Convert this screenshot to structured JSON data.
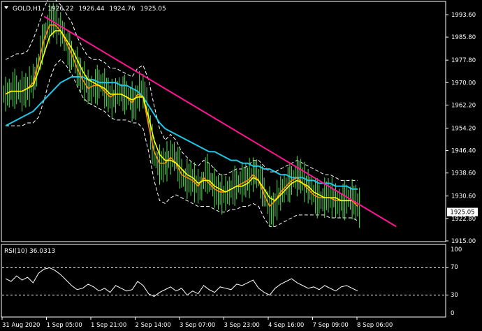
{
  "header": {
    "symbol": "GOLD,H1",
    "open": "1926.22",
    "high": "1926.44",
    "low": "1924.76",
    "close": "1925.05",
    "menu_icon": "triangle-down-icon"
  },
  "price_badge": "1925.05",
  "rsi": {
    "label": "RSI(10) 36.0313",
    "ticks": [
      "100",
      "70",
      "30",
      "0"
    ]
  },
  "colors": {
    "background": "#000000",
    "frame": "#ffffff",
    "bars": "#4fe04f",
    "ma_fast": "#ff8c00",
    "ma_slow": "#ffff00",
    "ma_long": "#1ec8e6",
    "bands": "#ffffff",
    "trendline": "#ff1493",
    "rsi_line": "#ffffff"
  },
  "chart_data": {
    "type": "line",
    "price_axis": {
      "ticks": [
        "1993.60",
        "1985.80",
        "1977.80",
        "1970.00",
        "1962.20",
        "1954.20",
        "1946.40",
        "1938.60",
        "1930.60",
        "1922.80",
        "1915.00"
      ],
      "ylim": [
        1915.0,
        1993.6
      ]
    },
    "time_axis": {
      "labels": [
        "31 Aug 2020",
        "1 Sep 05:00",
        "1 Sep 21:00",
        "2 Sep 14:00",
        "3 Sep 07:00",
        "3 Sep 23:00",
        "4 Sep 16:00",
        "7 Sep 09:00",
        "8 Sep 06:00"
      ]
    },
    "close": [
      1966,
      1968,
      1967,
      1967,
      1969,
      1972,
      1982,
      1989,
      1992,
      1990,
      1987,
      1981,
      1978,
      1973,
      1970,
      1967,
      1969,
      1970,
      1966,
      1964,
      1967,
      1966,
      1965,
      1962,
      1968,
      1966,
      1950,
      1942,
      1941,
      1943,
      1945,
      1941,
      1936,
      1937,
      1935,
      1933,
      1939,
      1935,
      1932,
      1931,
      1932,
      1934,
      1935,
      1936,
      1937,
      1939,
      1935,
      1929,
      1925,
      1930,
      1933,
      1935,
      1937,
      1938,
      1935,
      1933,
      1930,
      1929,
      1931,
      1930,
      1928,
      1929,
      1930,
      1929,
      1926
    ],
    "ma_fast": [
      1966,
      1967,
      1967,
      1967,
      1968,
      1970,
      1977,
      1985,
      1990,
      1990,
      1988,
      1984,
      1980,
      1975,
      1971,
      1968,
      1969,
      1969,
      1967,
      1965,
      1966,
      1966,
      1965,
      1963,
      1966,
      1965,
      1955,
      1946,
      1942,
      1942,
      1944,
      1942,
      1938,
      1937,
      1936,
      1934,
      1937,
      1935,
      1933,
      1932,
      1932,
      1933,
      1934,
      1935,
      1936,
      1938,
      1936,
      1931,
      1927,
      1929,
      1932,
      1934,
      1936,
      1937,
      1935,
      1933,
      1931,
      1930,
      1930,
      1930,
      1929,
      1929,
      1929,
      1929,
      1927
    ],
    "ma_slow": [
      1966,
      1967,
      1967,
      1967,
      1968,
      1969,
      1974,
      1980,
      1986,
      1988,
      1988,
      1985,
      1982,
      1978,
      1974,
      1971,
      1970,
      1969,
      1968,
      1966,
      1966,
      1966,
      1965,
      1964,
      1965,
      1965,
      1958,
      1950,
      1945,
      1943,
      1943,
      1942,
      1940,
      1938,
      1937,
      1935,
      1936,
      1936,
      1934,
      1933,
      1932,
      1933,
      1934,
      1934,
      1935,
      1937,
      1936,
      1933,
      1930,
      1929,
      1931,
      1933,
      1935,
      1936,
      1935,
      1934,
      1932,
      1931,
      1930,
      1930,
      1930,
      1929,
      1929,
      1929,
      1928
    ],
    "ma_long": [
      1955,
      1956,
      1957,
      1958,
      1959,
      1960,
      1962,
      1964,
      1966,
      1968,
      1970,
      1971,
      1972,
      1972,
      1972,
      1971,
      1971,
      1970,
      1970,
      1970,
      1970,
      1969,
      1969,
      1968,
      1967,
      1965,
      1962,
      1959,
      1956,
      1954,
      1953,
      1952,
      1951,
      1950,
      1949,
      1948,
      1947,
      1946,
      1946,
      1945,
      1944,
      1943,
      1943,
      1942,
      1942,
      1941,
      1941,
      1940,
      1940,
      1939,
      1938,
      1938,
      1937,
      1937,
      1937,
      1936,
      1936,
      1935,
      1935,
      1935,
      1934,
      1934,
      1934,
      1933,
      1933
    ],
    "band_upper": [
      1978,
      1979,
      1980,
      1980,
      1981,
      1985,
      1990,
      1996,
      2000,
      1999,
      1997,
      1994,
      1991,
      1986,
      1982,
      1979,
      1978,
      1978,
      1977,
      1975,
      1975,
      1974,
      1973,
      1972,
      1975,
      1976,
      1971,
      1962,
      1954,
      1950,
      1952,
      1950,
      1946,
      1944,
      1942,
      1941,
      1943,
      1942,
      1940,
      1938,
      1938,
      1939,
      1940,
      1940,
      1941,
      1943,
      1943,
      1941,
      1939,
      1939,
      1940,
      1941,
      1942,
      1943,
      1942,
      1941,
      1940,
      1939,
      1938,
      1938,
      1937,
      1936,
      1936,
      1936,
      1936
    ],
    "band_lower": [
      1955,
      1955,
      1955,
      1955,
      1956,
      1956,
      1958,
      1964,
      1971,
      1976,
      1978,
      1976,
      1973,
      1969,
      1965,
      1963,
      1962,
      1961,
      1960,
      1958,
      1957,
      1957,
      1957,
      1956,
      1956,
      1954,
      1946,
      1936,
      1929,
      1928,
      1930,
      1931,
      1930,
      1929,
      1928,
      1927,
      1927,
      1927,
      1926,
      1925,
      1925,
      1926,
      1926,
      1927,
      1927,
      1928,
      1927,
      1923,
      1920,
      1920,
      1921,
      1922,
      1923,
      1924,
      1924,
      1924,
      1924,
      1924,
      1924,
      1923,
      1923,
      1923,
      1923,
      1923,
      1922
    ],
    "trendline": {
      "from": [
        7,
        1993.0
      ],
      "to": [
        71,
        1920.0
      ]
    },
    "rsi_scale": {
      "ylim": [
        0,
        100
      ],
      "levels": [
        70,
        30
      ]
    },
    "rsi_values": [
      54,
      50,
      58,
      52,
      56,
      48,
      62,
      68,
      70,
      66,
      60,
      52,
      44,
      38,
      40,
      46,
      42,
      36,
      40,
      34,
      44,
      40,
      36,
      38,
      50,
      44,
      32,
      28,
      34,
      38,
      42,
      36,
      40,
      30,
      36,
      32,
      44,
      38,
      34,
      42,
      40,
      38,
      46,
      44,
      48,
      52,
      40,
      34,
      30,
      40,
      46,
      50,
      54,
      48,
      44,
      40,
      42,
      38,
      44,
      40,
      36,
      42,
      44,
      40,
      36
    ]
  }
}
